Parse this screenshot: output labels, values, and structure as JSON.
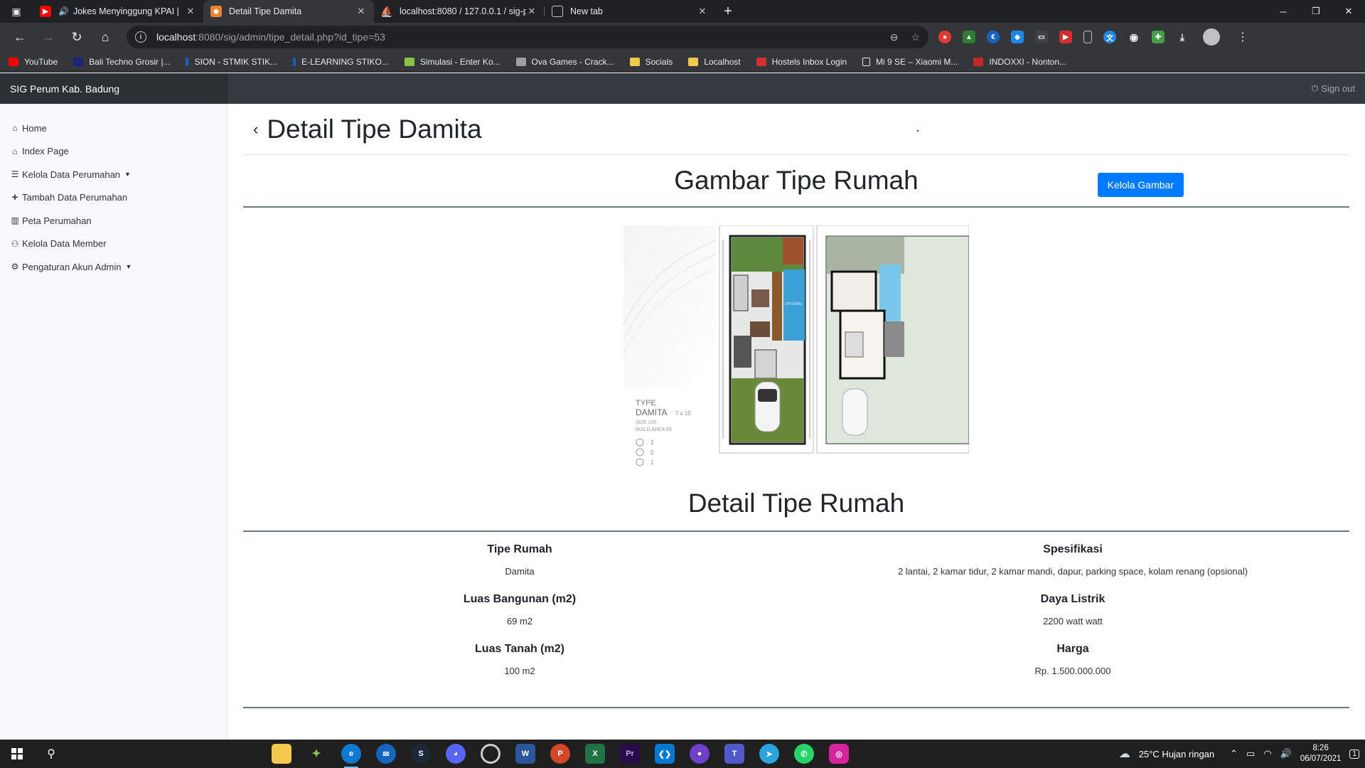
{
  "browser": {
    "tabs": [
      {
        "title": "Jokes Menyinggung KPAI |",
        "favicon_color": "#ff0000",
        "active": false
      },
      {
        "title": "Detail Tipe Damita",
        "favicon_color": "#e8822f",
        "active": true
      },
      {
        "title": "localhost:8080 / 127.0.0.1 / sig-p",
        "favicon_color": "#f29111",
        "active": false
      },
      {
        "title": "New tab",
        "favicon_color": "#5f6368",
        "active": false
      }
    ],
    "url_host": "localhost",
    "url_rest": ":8080/sig/admin/tipe_detail.php?id_tipe=53",
    "bookmarks": [
      {
        "label": "YouTube",
        "color": "#ff0000"
      },
      {
        "label": "Bali Techno Grosir |...",
        "color": "#1a237e"
      },
      {
        "label": "SION - STMIK STIK...",
        "color": "#1565c0"
      },
      {
        "label": "E-LEARNING STIKO...",
        "color": "#1565c0"
      },
      {
        "label": "Simulasi - Enter Ko...",
        "color": "#8bc34a"
      },
      {
        "label": "Ova Games - Crack...",
        "color": "#9e9e9e"
      },
      {
        "label": "Socials",
        "color": "#f2c94c"
      },
      {
        "label": "Localhost",
        "color": "#f2c94c"
      },
      {
        "label": "Hostels Inbox Login",
        "color": "#d32f2f"
      },
      {
        "label": "Mi 9 SE – Xiaomi M...",
        "color": "#e8eaed"
      },
      {
        "label": "INDOXXI - Nonton...",
        "color": "#c62828"
      }
    ]
  },
  "app": {
    "brand": "SIG Perum Kab. Badung",
    "signout": "Sign out",
    "sidebar": [
      {
        "icon": "home-icon",
        "glyph": "⌂",
        "label": "Home",
        "dropdown": false
      },
      {
        "icon": "home-icon",
        "glyph": "⌂",
        "label": "Index Page",
        "dropdown": false
      },
      {
        "icon": "list-icon",
        "glyph": "☰",
        "label": "Kelola Data Perumahan",
        "dropdown": true
      },
      {
        "icon": "plus-icon",
        "glyph": "+",
        "label": "Tambah Data Perumahan",
        "dropdown": false
      },
      {
        "icon": "map-icon",
        "glyph": "▥",
        "label": "Peta Perumahan",
        "dropdown": false
      },
      {
        "icon": "users-icon",
        "glyph": "⚇",
        "label": "Kelola Data Member",
        "dropdown": false
      },
      {
        "icon": "cog-icon",
        "glyph": "⚙",
        "label": "Pengaturan Akun Admin",
        "dropdown": true
      }
    ],
    "page_title": "Detail Tipe Damita",
    "gallery_title": "Gambar Tipe Rumah",
    "manage_images_button": "Kelola Gambar",
    "floorplan": {
      "type_label": "TYPE",
      "type_name": "DAMITA",
      "dimension": "7 x 15",
      "size_line": "SIZE  105",
      "build_line": "BUILD AREA  69",
      "bed_count": "2",
      "bath_count": "2",
      "car_count": "1",
      "pool_tag": "OPTIONAL"
    },
    "detail_title": "Detail Tipe Rumah",
    "details": [
      {
        "label": "Tipe Rumah",
        "value": "Damita"
      },
      {
        "label": "Spesifikasi",
        "value": "2 lantai, 2 kamar tidur, 2 kamar mandi, dapur, parking space, kolam renang (opsional)"
      },
      {
        "label": "Luas Bangunan (m2)",
        "value": "69 m2"
      },
      {
        "label": "Daya Listrik",
        "value": "2200 watt watt"
      },
      {
        "label": "Luas Tanah (m2)",
        "value": "100 m2"
      },
      {
        "label": "Harga",
        "value": "Rp. 1.500.000.000"
      }
    ]
  },
  "taskbar": {
    "weather": "25°C  Hujan ringan",
    "time": "8:26",
    "date": "06/07/2021",
    "notifications": "1"
  }
}
